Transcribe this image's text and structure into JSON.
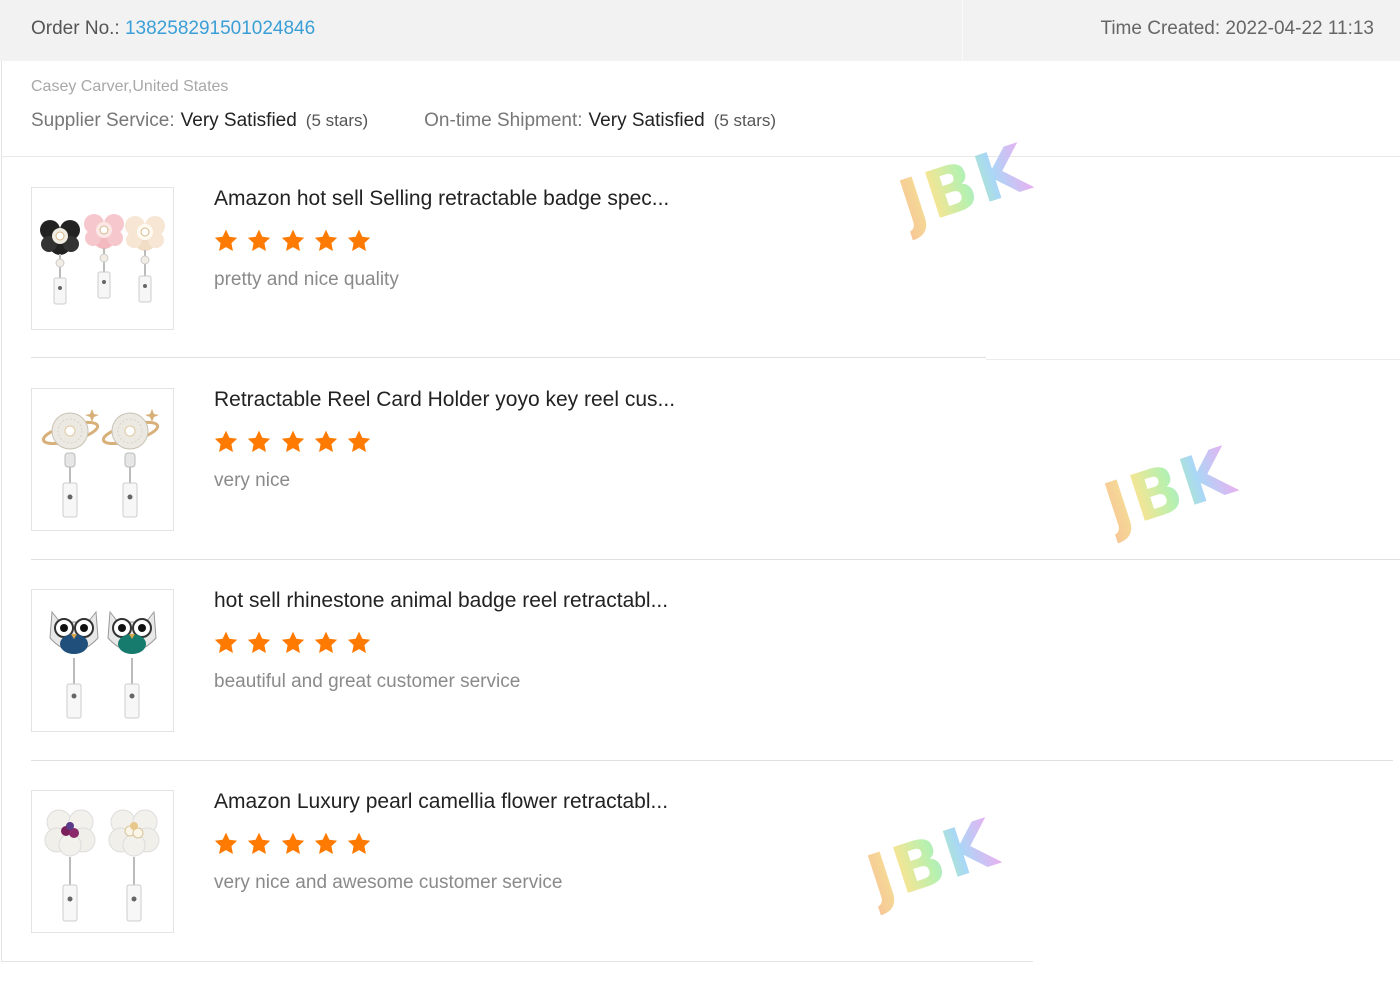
{
  "order": {
    "label": "Order No.: ",
    "number": "138258291501024846",
    "time_created_label": "Time Created: ",
    "time_created": "2022-04-22 11:13"
  },
  "buyer": "Casey Carver,United States",
  "ratings": {
    "supplier_label": "Supplier Service:",
    "supplier_value": "Very Satisfied",
    "supplier_stars": "(5 stars)",
    "shipment_label": "On-time Shipment:",
    "shipment_value": "Very Satisfied",
    "shipment_stars": "(5 stars)"
  },
  "items": [
    {
      "title": "Amazon hot sell Selling retractable badge spec...",
      "stars": 5,
      "comment": "pretty and nice quality",
      "image": "camellia-flower-badge-reels-product-photo"
    },
    {
      "title": "Retractable Reel Card Holder yoyo key reel cus...",
      "stars": 5,
      "comment": "very nice",
      "image": "planet-rhinestone-badge-reels-product-photo"
    },
    {
      "title": "hot sell rhinestone animal badge reel retractabl...",
      "stars": 5,
      "comment": "beautiful and great customer service",
      "image": "owl-rhinestone-badge-reels-product-photo"
    },
    {
      "title": "Amazon Luxury pearl camellia flower retractabl...",
      "stars": 5,
      "comment": "very nice and awesome customer service",
      "image": "pearl-camellia-badge-reels-product-photo"
    }
  ],
  "watermark": "JBK",
  "colors": {
    "order_number": "#3a9fd8",
    "star": "#ff7a00",
    "header_bg": "#f2f2f2"
  }
}
